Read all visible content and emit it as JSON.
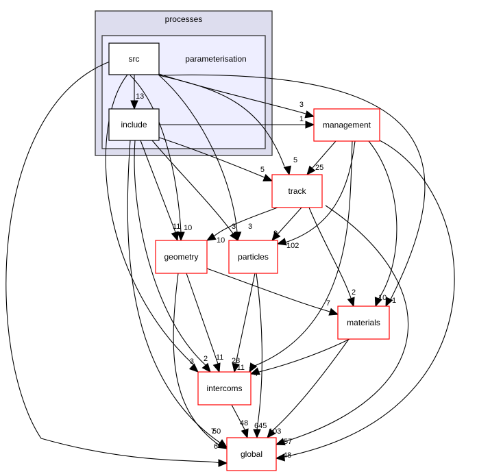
{
  "clusters": {
    "outer": {
      "label": "processes",
      "fill": "#ddddee",
      "stroke": "#333333"
    },
    "inner": {
      "label": "parameterisation",
      "fill": "#eeeeff",
      "stroke": "#333333"
    }
  },
  "nodes": [
    {
      "id": "src",
      "label": "src",
      "border": "#000000"
    },
    {
      "id": "include",
      "label": "include",
      "border": "#000000"
    },
    {
      "id": "management",
      "label": "management",
      "border": "#ff0000"
    },
    {
      "id": "track",
      "label": "track",
      "border": "#ff0000"
    },
    {
      "id": "geometry",
      "label": "geometry",
      "border": "#ff0000"
    },
    {
      "id": "particles",
      "label": "particles",
      "border": "#ff0000"
    },
    {
      "id": "materials",
      "label": "materials",
      "border": "#ff0000"
    },
    {
      "id": "intercoms",
      "label": "intercoms",
      "border": "#ff0000"
    },
    {
      "id": "global",
      "label": "global",
      "border": "#ff0000"
    }
  ],
  "edges": [
    {
      "from": "src",
      "to": "include",
      "label": "13"
    },
    {
      "from": "src",
      "to": "management",
      "label": "3"
    },
    {
      "from": "include",
      "to": "management",
      "label": "1"
    },
    {
      "from": "src",
      "to": "track",
      "label": "5"
    },
    {
      "from": "include",
      "to": "track",
      "label": "5"
    },
    {
      "from": "management",
      "to": "track",
      "label": "25"
    },
    {
      "from": "include",
      "to": "geometry",
      "label": "11"
    },
    {
      "from": "src",
      "to": "geometry",
      "label": "10"
    },
    {
      "from": "track",
      "to": "geometry",
      "label": "10"
    },
    {
      "from": "include",
      "to": "particles",
      "label": "3"
    },
    {
      "from": "src",
      "to": "particles",
      "label": "3"
    },
    {
      "from": "track",
      "to": "particles",
      "label": "9"
    },
    {
      "from": "management",
      "to": "particles",
      "label": "102"
    },
    {
      "from": "geometry",
      "to": "materials",
      "label": "7"
    },
    {
      "from": "track",
      "to": "materials",
      "label": "2"
    },
    {
      "from": "management",
      "to": "materials",
      "label": "10"
    },
    {
      "from": "src",
      "to": "materials",
      "label": "1"
    },
    {
      "from": "src",
      "to": "intercoms",
      "label": "3"
    },
    {
      "from": "include",
      "to": "intercoms",
      "label": "2"
    },
    {
      "from": "geometry",
      "to": "intercoms",
      "label": "11"
    },
    {
      "from": "particles",
      "to": "intercoms",
      "label": "28"
    },
    {
      "from": "management",
      "to": "intercoms",
      "label": "11"
    },
    {
      "from": "materials",
      "to": "intercoms",
      "label": "4"
    },
    {
      "from": "include",
      "to": "global",
      "label": "50"
    },
    {
      "from": "geometry",
      "to": "global",
      "label": "7"
    },
    {
      "from": "src",
      "to": "global",
      "label": "6"
    },
    {
      "from": "intercoms",
      "to": "global",
      "label": "48"
    },
    {
      "from": "particles",
      "to": "global",
      "label": "645"
    },
    {
      "from": "materials",
      "to": "global",
      "label": "103"
    },
    {
      "from": "track",
      "to": "global",
      "label": "57"
    },
    {
      "from": "management",
      "to": "global",
      "label": "48"
    }
  ]
}
